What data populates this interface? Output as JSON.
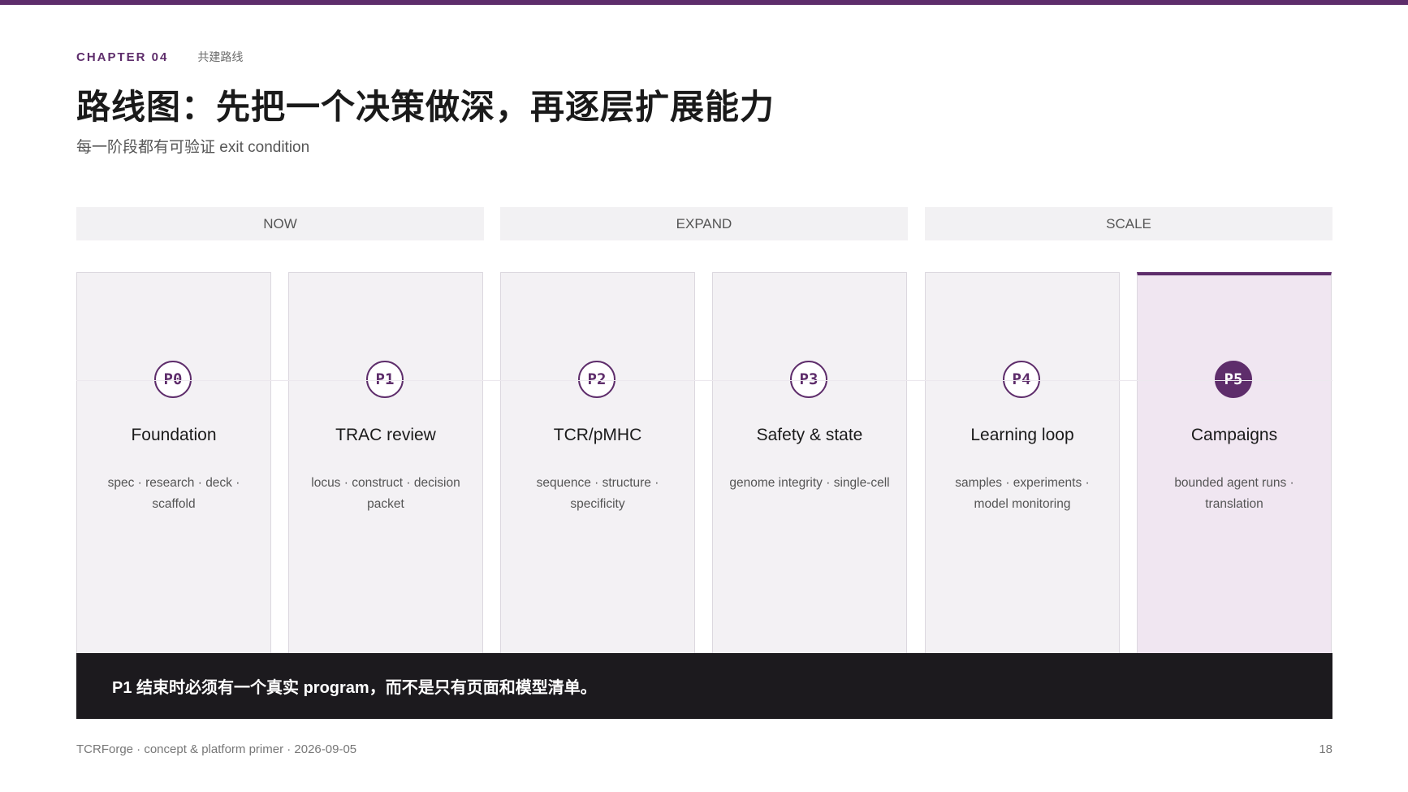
{
  "header": {
    "chapter_label": "CHAPTER 04",
    "chapter_sub": "共建路线",
    "title": "路线图：先把一个决策做深，再逐层扩展能力",
    "subtitle": "每一阶段都有可验证 exit condition"
  },
  "phases": [
    {
      "label": "NOW"
    },
    {
      "label": "EXPAND"
    },
    {
      "label": "SCALE"
    }
  ],
  "stages": [
    {
      "badge": "P0",
      "title": "Foundation",
      "desc": "spec · research · deck · scaffold",
      "active": false
    },
    {
      "badge": "P1",
      "title": "TRAC review",
      "desc": "locus · construct · decision packet",
      "active": false
    },
    {
      "badge": "P2",
      "title": "TCR/pMHC",
      "desc": "sequence · structure · specificity",
      "active": false
    },
    {
      "badge": "P3",
      "title": "Safety & state",
      "desc": "genome integrity · single-cell",
      "active": false
    },
    {
      "badge": "P4",
      "title": "Learning loop",
      "desc": "samples · experiments · model monitoring",
      "active": false
    },
    {
      "badge": "P5",
      "title": "Campaigns",
      "desc": "bounded agent runs · translation",
      "active": true
    }
  ],
  "callout": "P1 结束时必须有一个真实 program，而不是只有页面和模型清单。",
  "footer": {
    "text": "TCRForge · concept & platform primer · 2026-09-05",
    "page": "18"
  },
  "colors": {
    "accent": "#5e2d6b",
    "card_bg": "#f3f1f4",
    "active_card_bg": "#f0e6f1",
    "callout_bg": "#1c1a1e"
  }
}
